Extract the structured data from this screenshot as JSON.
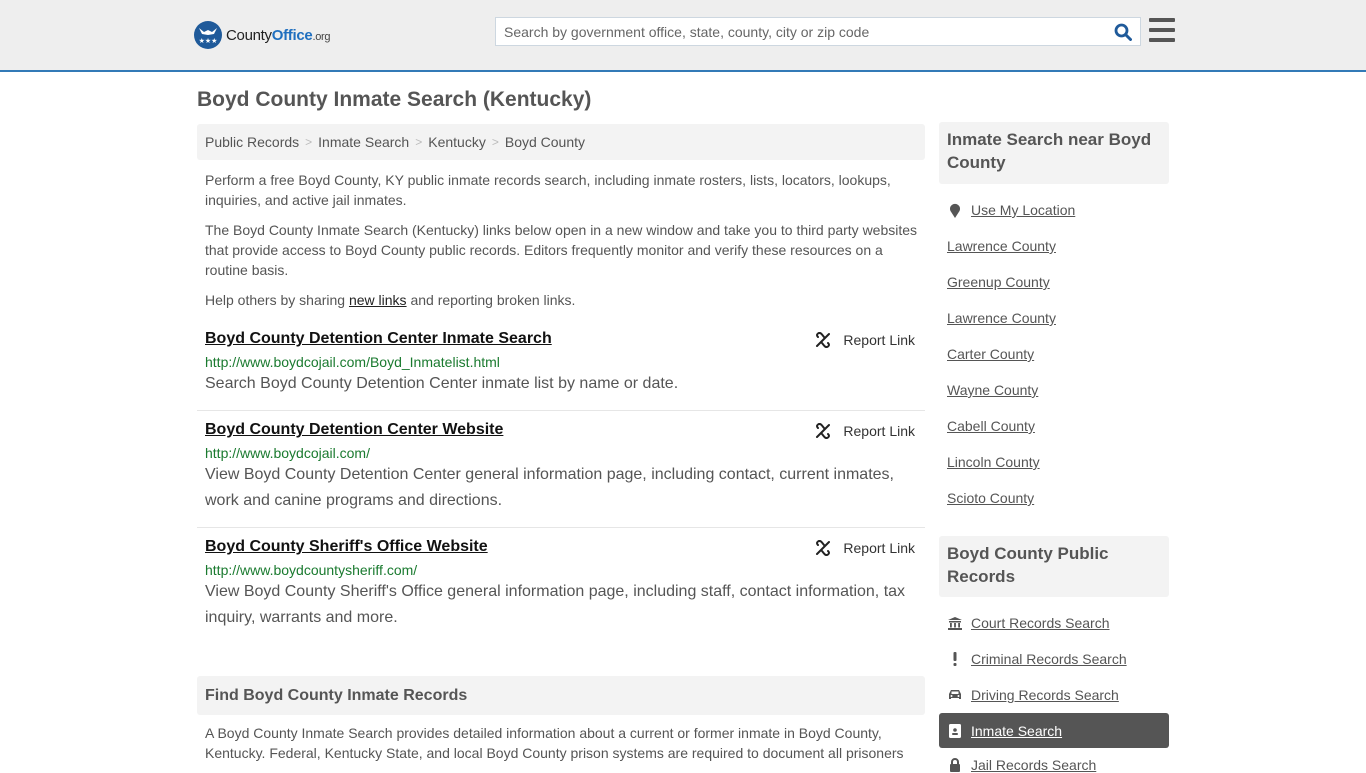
{
  "header": {
    "logo_name": "County",
    "logo_name_bold": "Office",
    "logo_tld": ".org",
    "search_placeholder": "Search by government office, state, county, city or zip code",
    "search_icon": "search-icon",
    "menu_icon": "hamburger-menu-icon"
  },
  "page": {
    "title": "Boyd County Inmate Search (Kentucky)"
  },
  "breadcrumb": [
    {
      "label": "Public Records"
    },
    {
      "label": "Inmate Search"
    },
    {
      "label": "Kentucky"
    },
    {
      "label": "Boyd County"
    }
  ],
  "breadcrumb_separator": ">",
  "intro": {
    "p1": "Perform a free Boyd County, KY public inmate records search, including inmate rosters, lists, locators, lookups, inquiries, and active jail inmates.",
    "p2": "The Boyd County Inmate Search (Kentucky) links below open in a new window and take you to third party websites that provide access to Boyd County public records. Editors frequently monitor and verify these resources on a routine basis.",
    "p3_before": "Help others by sharing ",
    "p3_link": "new links",
    "p3_after": " and reporting broken links."
  },
  "results": [
    {
      "title": "Boyd County Detention Center Inmate Search",
      "url": "http://www.boydcojail.com/Boyd_Inmatelist.html",
      "description": "Search Boyd County Detention Center inmate list by name or date.",
      "report_label": "Report Link"
    },
    {
      "title": "Boyd County Detention Center Website",
      "url": "http://www.boydcojail.com/",
      "description": "View Boyd County Detention Center general information page, including contact, current inmates, work and canine programs and directions.",
      "report_label": "Report Link"
    },
    {
      "title": "Boyd County Sheriff's Office Website",
      "url": "http://www.boydcountysheriff.com/",
      "description": "View Boyd County Sheriff's Office general information page, including staff, contact information, tax inquiry, warrants and more.",
      "report_label": "Report Link"
    }
  ],
  "find_section": {
    "heading": "Find Boyd County Inmate Records",
    "text": "A Boyd County Inmate Search provides detailed information about a current or former inmate in Boyd County, Kentucky. Federal, Kentucky State, and local Boyd County prison systems are required to document all prisoners"
  },
  "sidebar": {
    "nearby_heading": "Inmate Search near Boyd County",
    "use_location": "Use My Location",
    "nearby": [
      {
        "label": "Lawrence County"
      },
      {
        "label": "Greenup County"
      },
      {
        "label": "Lawrence County"
      },
      {
        "label": "Carter County"
      },
      {
        "label": "Wayne County"
      },
      {
        "label": "Cabell County"
      },
      {
        "label": "Lincoln County"
      },
      {
        "label": "Scioto County"
      }
    ],
    "records_heading": "Boyd County Public Records",
    "records": [
      {
        "label": "Court Records Search",
        "icon": "courthouse-icon"
      },
      {
        "label": "Criminal Records Search",
        "icon": "exclamation-icon"
      },
      {
        "label": "Driving Records Search",
        "icon": "car-icon"
      },
      {
        "label": "Inmate Search",
        "icon": "id-badge-icon",
        "active": true
      },
      {
        "label": "Jail Records Search",
        "icon": "lock-icon"
      }
    ]
  },
  "colors": {
    "accent": "#337ab7",
    "url_green": "#1a7a2f",
    "active_bg": "#555555",
    "panel_bg": "#f3f3f3"
  }
}
